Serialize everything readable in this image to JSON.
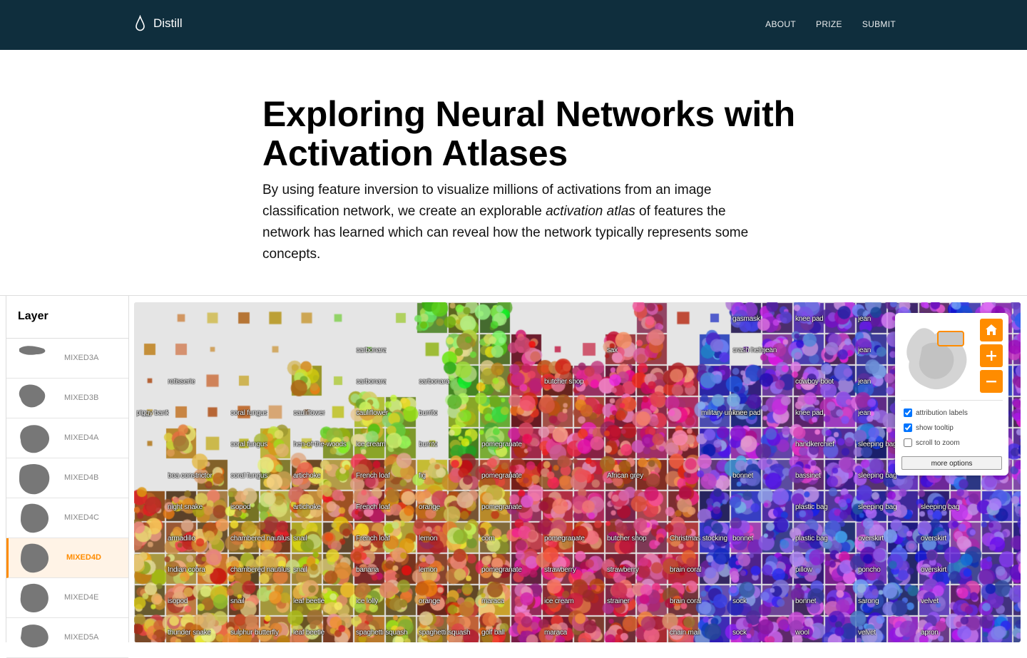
{
  "header": {
    "brand": "Distill",
    "nav": [
      "ABOUT",
      "PRIZE",
      "SUBMIT"
    ]
  },
  "article": {
    "title_line1": "Exploring Neural Networks with",
    "title_line2": "Activation Atlases",
    "abstract_before": "By using feature inversion to visualize millions of activations from an image classification network, we create an explorable ",
    "abstract_emph": "activation atlas",
    "abstract_after": " of features the network has learned which can reveal how the network typically represents some concepts."
  },
  "layer_panel": {
    "title": "Layer",
    "layers": [
      "MIXED3A",
      "MIXED3B",
      "MIXED4A",
      "MIXED4B",
      "MIXED4C",
      "MIXED4D",
      "MIXED4E",
      "MIXED5A"
    ],
    "selected": "MIXED4D"
  },
  "controls": {
    "options": [
      {
        "label": "attribution labels",
        "checked": true
      },
      {
        "label": "show tooltip",
        "checked": true
      },
      {
        "label": "scroll to zoom",
        "checked": false
      }
    ],
    "more_button": "more options"
  },
  "colors": {
    "header_bg": "#0f2e3d",
    "accent": "#ff8c00",
    "atlas_bg": "#e5e5e5"
  },
  "atlas": {
    "labels": [
      {
        "text": "gasmask",
        "col": 19,
        "row": 0
      },
      {
        "text": "knee pad",
        "col": 21,
        "row": 0
      },
      {
        "text": "jean",
        "col": 23,
        "row": 0
      },
      {
        "text": "carbonara",
        "col": 7,
        "row": 1
      },
      {
        "text": "sax",
        "col": 15,
        "row": 1
      },
      {
        "text": "crash helmet",
        "col": 19,
        "row": 1
      },
      {
        "text": "jean",
        "col": 20,
        "row": 1
      },
      {
        "text": "jean",
        "col": 23,
        "row": 1
      },
      {
        "text": "rotisserie",
        "col": 1,
        "row": 2
      },
      {
        "text": "carbonara",
        "col": 7,
        "row": 2
      },
      {
        "text": "carbonara",
        "col": 9,
        "row": 2
      },
      {
        "text": "butcher shop",
        "col": 13,
        "row": 2
      },
      {
        "text": "cowboy boot",
        "col": 21,
        "row": 2
      },
      {
        "text": "jean",
        "col": 23,
        "row": 2
      },
      {
        "text": "piggy bank",
        "col": 0,
        "row": 3
      },
      {
        "text": "coral fungus",
        "col": 3,
        "row": 3
      },
      {
        "text": "cauliflower",
        "col": 5,
        "row": 3
      },
      {
        "text": "cauliflower",
        "col": 7,
        "row": 3
      },
      {
        "text": "burrito",
        "col": 9,
        "row": 3
      },
      {
        "text": "military uniform",
        "col": 18,
        "row": 3
      },
      {
        "text": "knee pad",
        "col": 19,
        "row": 3
      },
      {
        "text": "knee pad",
        "col": 21,
        "row": 3
      },
      {
        "text": "jean",
        "col": 23,
        "row": 3
      },
      {
        "text": "coral fungus",
        "col": 3,
        "row": 4
      },
      {
        "text": "hen-of-the-woods",
        "col": 5,
        "row": 4
      },
      {
        "text": "ice cream",
        "col": 7,
        "row": 4
      },
      {
        "text": "burrito",
        "col": 9,
        "row": 4
      },
      {
        "text": "pomegranate",
        "col": 11,
        "row": 4
      },
      {
        "text": "handkerchief",
        "col": 21,
        "row": 4
      },
      {
        "text": "sleeping bag",
        "col": 23,
        "row": 4
      },
      {
        "text": "boa constrictor",
        "col": 1,
        "row": 5
      },
      {
        "text": "coral fungus",
        "col": 3,
        "row": 5
      },
      {
        "text": "artichoke",
        "col": 5,
        "row": 5
      },
      {
        "text": "French loaf",
        "col": 7,
        "row": 5
      },
      {
        "text": "fig",
        "col": 9,
        "row": 5
      },
      {
        "text": "pomegranate",
        "col": 11,
        "row": 5
      },
      {
        "text": "African grey",
        "col": 15,
        "row": 5
      },
      {
        "text": "bonnet",
        "col": 19,
        "row": 5
      },
      {
        "text": "bassinet",
        "col": 21,
        "row": 5
      },
      {
        "text": "sleeping bag",
        "col": 23,
        "row": 5
      },
      {
        "text": "night snake",
        "col": 1,
        "row": 6
      },
      {
        "text": "isopod",
        "col": 3,
        "row": 6
      },
      {
        "text": "artichoke",
        "col": 5,
        "row": 6
      },
      {
        "text": "French loaf",
        "col": 7,
        "row": 6
      },
      {
        "text": "orange",
        "col": 9,
        "row": 6
      },
      {
        "text": "pomegranate",
        "col": 11,
        "row": 6
      },
      {
        "text": "plastic bag",
        "col": 21,
        "row": 6
      },
      {
        "text": "sleeping bag",
        "col": 23,
        "row": 6
      },
      {
        "text": "sleeping bag",
        "col": 25,
        "row": 6
      },
      {
        "text": "armadillo",
        "col": 1,
        "row": 7
      },
      {
        "text": "chambered nautilus",
        "col": 3,
        "row": 7
      },
      {
        "text": "snail",
        "col": 5,
        "row": 7
      },
      {
        "text": "French loaf",
        "col": 7,
        "row": 7
      },
      {
        "text": "lemon",
        "col": 9,
        "row": 7
      },
      {
        "text": "corn",
        "col": 11,
        "row": 7
      },
      {
        "text": "pomegranate",
        "col": 13,
        "row": 7
      },
      {
        "text": "butcher shop",
        "col": 15,
        "row": 7
      },
      {
        "text": "Christmas stocking",
        "col": 17,
        "row": 7
      },
      {
        "text": "bonnet",
        "col": 19,
        "row": 7
      },
      {
        "text": "plastic bag",
        "col": 21,
        "row": 7
      },
      {
        "text": "overskirt",
        "col": 23,
        "row": 7
      },
      {
        "text": "overskirt",
        "col": 25,
        "row": 7
      },
      {
        "text": "Indian cobra",
        "col": 1,
        "row": 8
      },
      {
        "text": "chambered nautilus",
        "col": 3,
        "row": 8
      },
      {
        "text": "snail",
        "col": 5,
        "row": 8
      },
      {
        "text": "banana",
        "col": 7,
        "row": 8
      },
      {
        "text": "lemon",
        "col": 9,
        "row": 8
      },
      {
        "text": "pomegranate",
        "col": 11,
        "row": 8
      },
      {
        "text": "strawberry",
        "col": 13,
        "row": 8
      },
      {
        "text": "strawberry",
        "col": 15,
        "row": 8
      },
      {
        "text": "brain coral",
        "col": 17,
        "row": 8
      },
      {
        "text": "pillow",
        "col": 21,
        "row": 8
      },
      {
        "text": "poncho",
        "col": 23,
        "row": 8
      },
      {
        "text": "overskirt",
        "col": 25,
        "row": 8
      },
      {
        "text": "isopod",
        "col": 1,
        "row": 9
      },
      {
        "text": "snail",
        "col": 3,
        "row": 9
      },
      {
        "text": "leaf beetle",
        "col": 5,
        "row": 9
      },
      {
        "text": "ice lolly",
        "col": 7,
        "row": 9
      },
      {
        "text": "orange",
        "col": 9,
        "row": 9
      },
      {
        "text": "maraca",
        "col": 11,
        "row": 9
      },
      {
        "text": "ice cream",
        "col": 13,
        "row": 9
      },
      {
        "text": "strainer",
        "col": 15,
        "row": 9
      },
      {
        "text": "brain coral",
        "col": 17,
        "row": 9
      },
      {
        "text": "sock",
        "col": 19,
        "row": 9
      },
      {
        "text": "bonnet",
        "col": 21,
        "row": 9
      },
      {
        "text": "sarong",
        "col": 23,
        "row": 9
      },
      {
        "text": "velvet",
        "col": 25,
        "row": 9
      },
      {
        "text": "thunder snake",
        "col": 1,
        "row": 10
      },
      {
        "text": "sulphur butterfly",
        "col": 3,
        "row": 10
      },
      {
        "text": "leaf beetle",
        "col": 5,
        "row": 10
      },
      {
        "text": "spaghetti squash",
        "col": 7,
        "row": 10
      },
      {
        "text": "spaghetti squash",
        "col": 9,
        "row": 10
      },
      {
        "text": "golf ball",
        "col": 11,
        "row": 10
      },
      {
        "text": "maraca",
        "col": 13,
        "row": 10
      },
      {
        "text": "chain mail",
        "col": 17,
        "row": 10
      },
      {
        "text": "sock",
        "col": 19,
        "row": 10
      },
      {
        "text": "wool",
        "col": 21,
        "row": 10
      },
      {
        "text": "velvet",
        "col": 23,
        "row": 10
      },
      {
        "text": "apron",
        "col": 25,
        "row": 10
      }
    ]
  }
}
